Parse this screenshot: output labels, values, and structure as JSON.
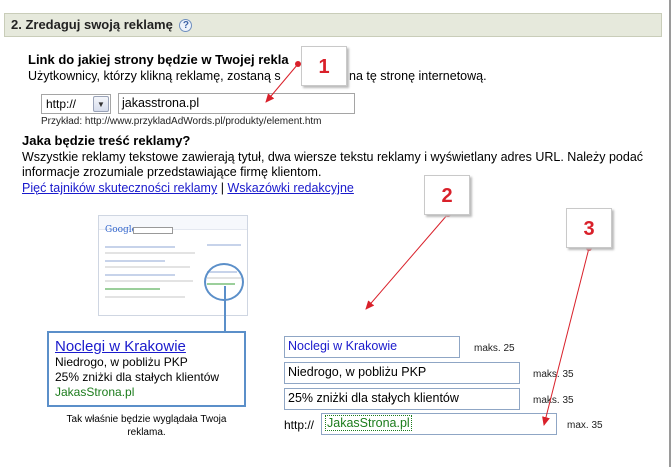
{
  "section": {
    "title": "2. Zredaguj swoją reklamę",
    "help": "?"
  },
  "link_question": {
    "title": "Link do jakiej strony będzie w Twojej rekla",
    "desc_start": "Użytkownicy, którzy klikną reklamę, zostaną s",
    "desc_end": "na tę stronę internetową.",
    "protocol": "http://",
    "url_value": "jakasstrona.pl",
    "example": "Przykład: http://www.przykladAdWords.pl/produkty/element.htm"
  },
  "content_question": {
    "title": "Jaka będzie treść reklamy?",
    "desc": "Wszystkie reklamy tekstowe zawierają tytuł, dwa wiersze tekstu reklamy i wyświetlany adres URL. Należy podać informacje zrozumiale przedstawiające firmę klientom.",
    "link1": "Pięć tajników skuteczności reklamy",
    "separator": "|",
    "link2": "Wskazówki redakcyjne"
  },
  "thumbnail": {
    "logo": "Google"
  },
  "preview": {
    "title": "Noclegi w Krakowie",
    "line1": "Niedrogo, w pobliżu PKP",
    "line2": "25% zniżki dla stałych klientów",
    "url": "JakasStrona.pl",
    "caption": "Tak właśnie będzie wyglądała Twoja reklama."
  },
  "fields": {
    "headline": {
      "value": "Noclegi w Krakowie",
      "limit": "maks. 25"
    },
    "line1": {
      "value": "Niedrogo, w pobliżu PKP",
      "limit": "maks. 35"
    },
    "line2": {
      "value": "25% zniżki dla stałych klientów",
      "limit": "maks. 35"
    },
    "display_url": {
      "prefix": "http://",
      "value": "JakasStrona.pl",
      "limit": "max. 35"
    }
  },
  "callouts": [
    "1",
    "2",
    "3"
  ],
  "colors": {
    "callout_red": "#d9202a",
    "link_blue": "#1a1acc",
    "url_green": "#1c7c1c",
    "header_bg": "#e6e9dc",
    "preview_border": "#5b8fc9"
  }
}
